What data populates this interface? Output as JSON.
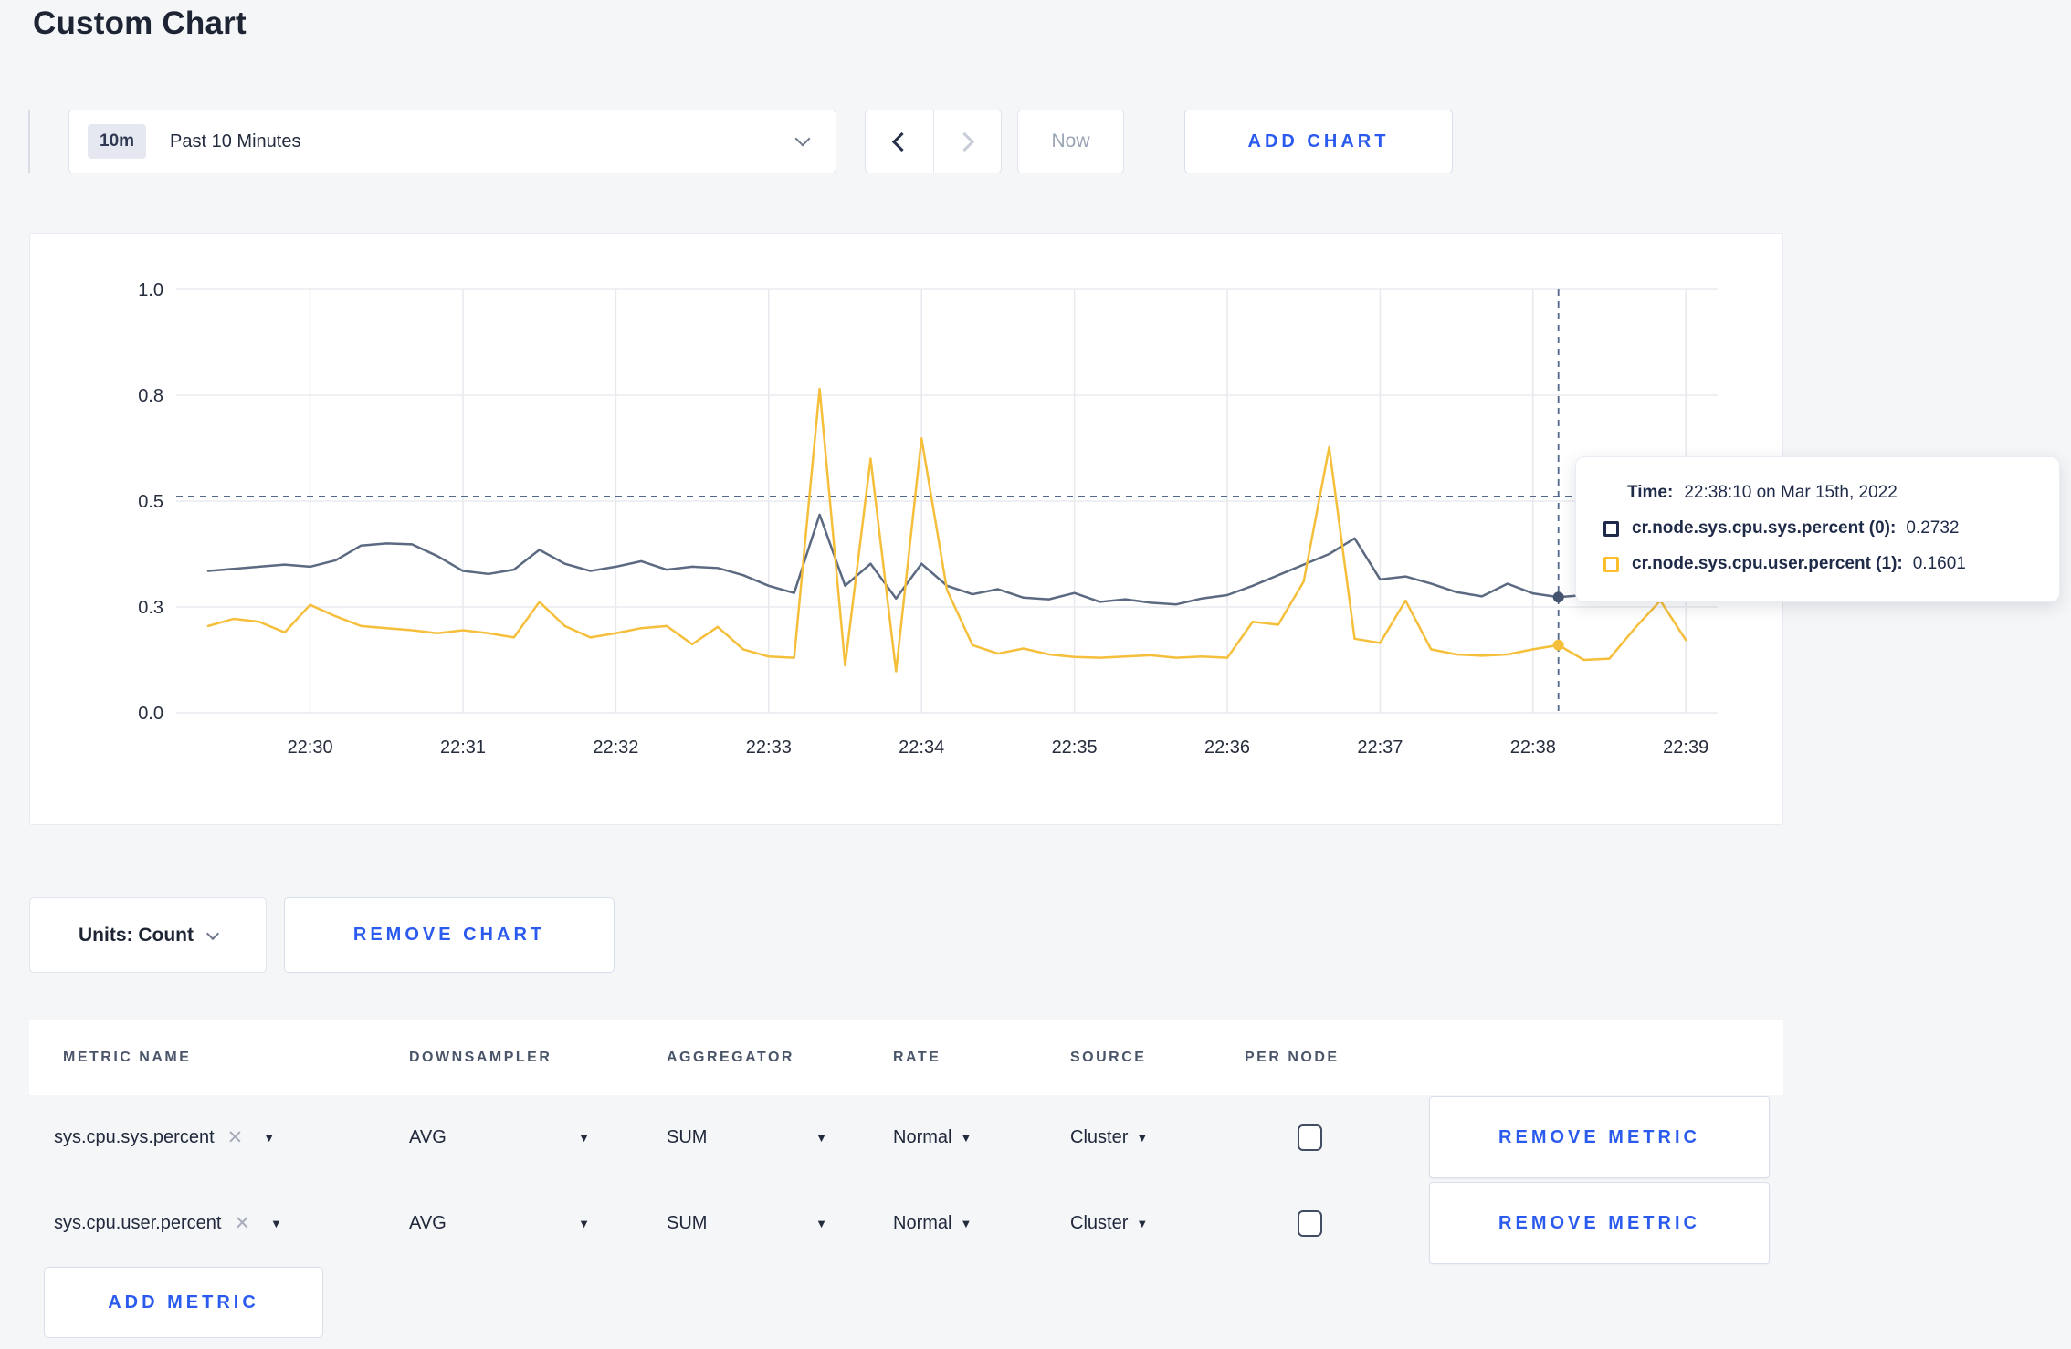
{
  "page": {
    "title": "Custom Chart"
  },
  "icons": {
    "caret_down": "▼",
    "close": "✕"
  },
  "toolbar": {
    "time_range_badge": "10m",
    "time_range_label": "Past 10 Minutes",
    "now_label": "Now",
    "add_chart_label": "ADD CHART"
  },
  "chart_footer": {
    "units_label": "Units: Count",
    "remove_chart_label": "REMOVE CHART"
  },
  "tooltip": {
    "time_label": "Time:",
    "time_value": "22:38:10 on Mar 15th, 2022",
    "rows": [
      {
        "label": "cr.node.sys.cpu.sys.percent (0):",
        "value": "0.2732",
        "swatch_color": "#1e2a48"
      },
      {
        "label": "cr.node.sys.cpu.user.percent (1):",
        "value": "0.1601",
        "swatch_color": "#fdc02c"
      }
    ]
  },
  "chart_data": {
    "type": "line",
    "title": "",
    "xlabel": "",
    "ylabel": "",
    "ylim": [
      0,
      1
    ],
    "grid": true,
    "y_ticks": [
      {
        "value": 0,
        "label": "0.0"
      },
      {
        "value": 0.25,
        "label": "0.3"
      },
      {
        "value": 0.5,
        "label": "0.5"
      },
      {
        "value": 0.75,
        "label": "0.8"
      },
      {
        "value": 1,
        "label": "1.0"
      }
    ],
    "x_start": "22:29:20",
    "x_interval_seconds": 10,
    "x_ticks": [
      {
        "index": 4,
        "label": "22:30"
      },
      {
        "index": 10,
        "label": "22:31"
      },
      {
        "index": 16,
        "label": "22:32"
      },
      {
        "index": 22,
        "label": "22:33"
      },
      {
        "index": 28,
        "label": "22:34"
      },
      {
        "index": 34,
        "label": "22:35"
      },
      {
        "index": 40,
        "label": "22:36"
      },
      {
        "index": 46,
        "label": "22:37"
      },
      {
        "index": 52,
        "label": "22:38"
      },
      {
        "index": 58,
        "label": "22:39"
      }
    ],
    "series": [
      {
        "name": "cr.node.sys.cpu.sys.percent (0)",
        "color": "#5b6981",
        "values": [
          0.335,
          0.34,
          0.345,
          0.35,
          0.345,
          0.36,
          0.395,
          0.4,
          0.398,
          0.37,
          0.335,
          0.328,
          0.338,
          0.385,
          0.352,
          0.335,
          0.345,
          0.358,
          0.338,
          0.345,
          0.342,
          0.325,
          0.3,
          0.283,
          0.468,
          0.3,
          0.352,
          0.27,
          0.352,
          0.3,
          0.28,
          0.292,
          0.272,
          0.268,
          0.283,
          0.262,
          0.268,
          0.26,
          0.256,
          0.27,
          0.278,
          0.3,
          0.325,
          0.35,
          0.375,
          0.412,
          0.315,
          0.322,
          0.305,
          0.285,
          0.275,
          0.305,
          0.282,
          0.2732,
          0.278,
          0.29,
          0.27,
          0.276,
          0.285
        ]
      },
      {
        "name": "cr.node.sys.cpu.user.percent (1)",
        "color": "#f5bf3b",
        "values": [
          0.205,
          0.222,
          0.215,
          0.19,
          0.255,
          0.228,
          0.205,
          0.2,
          0.195,
          0.188,
          0.195,
          0.188,
          0.178,
          0.262,
          0.205,
          0.178,
          0.188,
          0.2,
          0.205,
          0.162,
          0.203,
          0.15,
          0.133,
          0.13,
          0.765,
          0.112,
          0.6,
          0.098,
          0.648,
          0.29,
          0.16,
          0.14,
          0.152,
          0.138,
          0.132,
          0.13,
          0.133,
          0.136,
          0.13,
          0.133,
          0.13,
          0.215,
          0.208,
          0.31,
          0.627,
          0.175,
          0.165,
          0.265,
          0.15,
          0.138,
          0.135,
          0.138,
          0.15,
          0.1601,
          0.125,
          0.128,
          0.2,
          0.265,
          0.172
        ]
      }
    ],
    "cursor": {
      "index": 53,
      "time": "22:38:10",
      "crosshair_value": 0.511,
      "point_values": [
        0.2732,
        0.1601
      ]
    },
    "legend_position": "tooltip"
  },
  "metrics_table": {
    "headers": [
      "METRIC NAME",
      "DOWNSAMPLER",
      "AGGREGATOR",
      "RATE",
      "SOURCE",
      "PER NODE"
    ],
    "rows": [
      {
        "metric_name": "sys.cpu.sys.percent",
        "downsampler": "AVG",
        "aggregator": "SUM",
        "rate": "Normal",
        "source": "Cluster",
        "per_node_checked": false,
        "remove_label": "REMOVE METRIC"
      },
      {
        "metric_name": "sys.cpu.user.percent",
        "downsampler": "AVG",
        "aggregator": "SUM",
        "rate": "Normal",
        "source": "Cluster",
        "per_node_checked": false,
        "remove_label": "REMOVE METRIC"
      }
    ],
    "add_metric_label": "ADD METRIC"
  }
}
